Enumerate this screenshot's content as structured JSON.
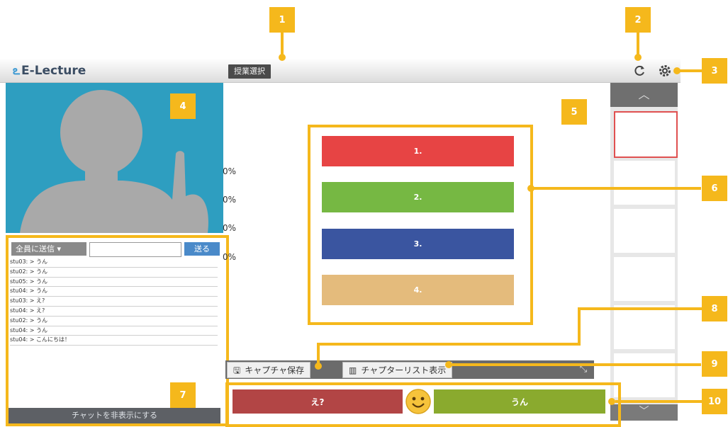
{
  "app": {
    "logo_text": "E-Lecture",
    "lecture_select": "授業選択"
  },
  "callouts": [
    "1",
    "2",
    "3",
    "4",
    "5",
    "6",
    "7",
    "8",
    "9",
    "10"
  ],
  "chat": {
    "recipient": "全員に送信",
    "send": "送る",
    "messages": [
      "stu03: > うん",
      "stu02: > うん",
      "stu05: > うん",
      "stu04: > うん",
      "stu03: > え?",
      "stu04: > え?",
      "stu02: > うん",
      "stu04: > うん",
      "stu04: > こんにちは！"
    ],
    "hide_chat": "チャットを非表示にする"
  },
  "percents": [
    "0%",
    "0%",
    "0%",
    "0%"
  ],
  "choices": [
    {
      "label": "1.",
      "color": "#e74444"
    },
    {
      "label": "2.",
      "color": "#76b843"
    },
    {
      "label": "3.",
      "color": "#3a55a0"
    },
    {
      "label": "4.",
      "color": "#e4bb7c"
    }
  ],
  "toolbar": {
    "capture_save": "キャプチャ保存",
    "chapter_list": "チャプターリスト表示"
  },
  "reactions": {
    "huh": "え?",
    "yes": "うん"
  },
  "icons": {
    "refresh": "refresh-icon",
    "settings": "gear-icon",
    "smiley": "smiley-icon"
  }
}
